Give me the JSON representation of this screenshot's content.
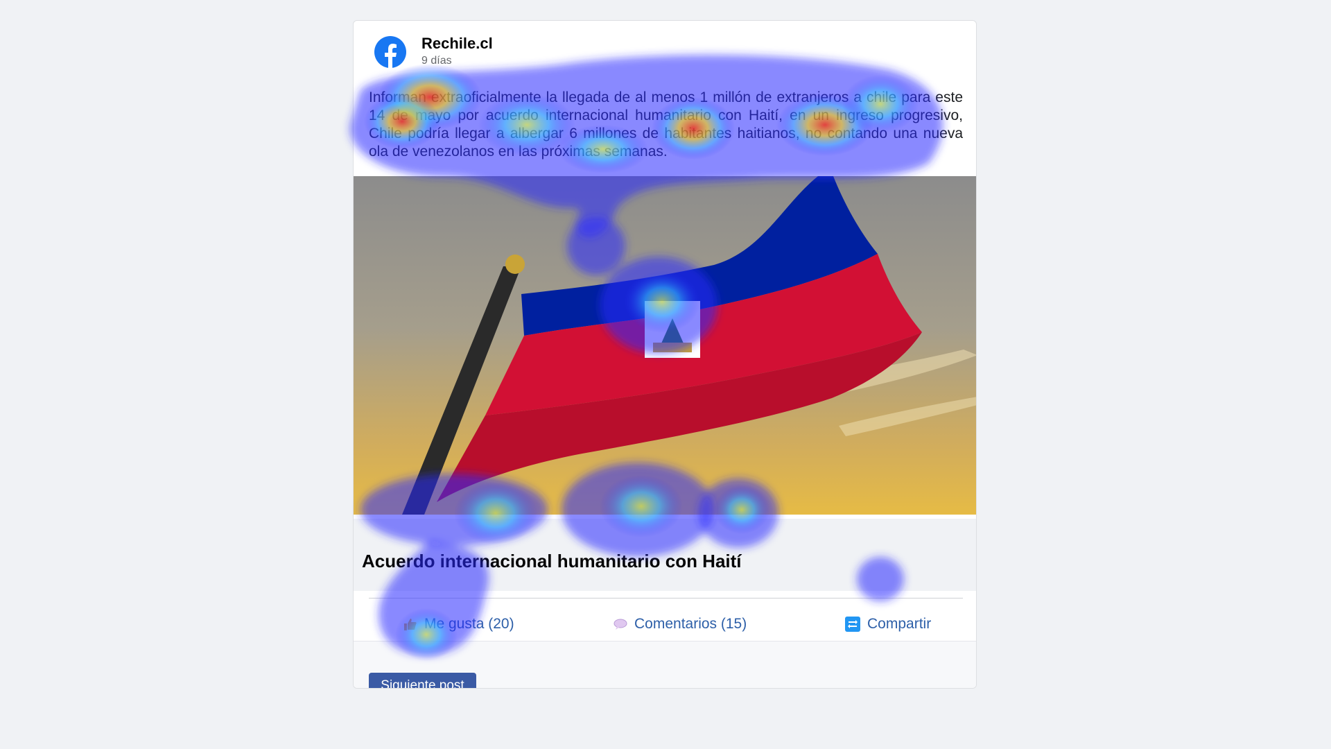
{
  "post": {
    "page_name": "Rechile.cl",
    "time": "9 días",
    "text": "Informan extraoficialmente la llegada de al menos 1 millón de extranjeros a chile para este 14 de mayo por acuerdo internacional humanitario con Haití, en un ingreso progresivo, Chile podría llegar a albergar 6 millones de habitantes haitianos, no contando una nueva ola de venezolanos en las próximas semanas.",
    "image_alt": "Haitian flag",
    "link_title": "Acuerdo internacional humanitario con Haití"
  },
  "actions": {
    "like_label": "Me gusta (20)",
    "comment_label": "Comentarios (15)",
    "share_label": "Compartir"
  },
  "footer": {
    "next_label": "Siguiente post"
  },
  "icons": {
    "brand": "facebook-logo-icon",
    "like": "thumbs-up-icon",
    "comment": "comment-bubble-icon",
    "share": "share-icon"
  },
  "colors": {
    "facebook_blue": "#1877f2",
    "action_text": "#2d5fa8",
    "button_bg": "#3b5ba5",
    "flag_blue": "#00209f",
    "flag_red": "#d21034"
  },
  "overlay": {
    "type": "gaze-heatmap"
  }
}
